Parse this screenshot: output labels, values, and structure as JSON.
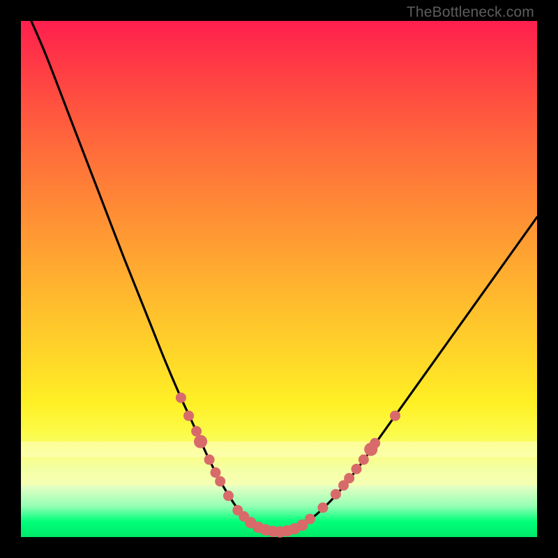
{
  "watermark": "TheBottleneck.com",
  "colors": {
    "frame_bg": "#000000",
    "dot_fill": "#d86a6a",
    "curve_stroke": "#000000"
  },
  "chart_data": {
    "type": "line",
    "title": "",
    "xlabel": "",
    "ylabel": "",
    "xlim": [
      0,
      100
    ],
    "ylim": [
      0,
      100
    ],
    "grid": false,
    "legend": false,
    "series": [
      {
        "name": "bottleneck-curve",
        "x": [
          2,
          5,
          10,
          15,
          20,
          25,
          28,
          31,
          34,
          36,
          38,
          40,
          42,
          44,
          46,
          48,
          50,
          52,
          55,
          60,
          65,
          70,
          75,
          80,
          85,
          90,
          95,
          100
        ],
        "y": [
          100,
          93,
          80,
          67,
          54,
          41.5,
          34,
          27,
          20.5,
          16,
          12,
          8.5,
          5.5,
          3.3,
          2,
          1.2,
          1,
          1.3,
          2.6,
          7,
          13,
          20,
          27,
          34,
          41,
          48,
          55,
          62
        ]
      }
    ],
    "scatter_points": {
      "name": "highlighted-dots",
      "points": [
        {
          "x": 31.0,
          "y": 27.0,
          "r": 1.1
        },
        {
          "x": 32.5,
          "y": 23.5,
          "r": 1.1
        },
        {
          "x": 34.0,
          "y": 20.5,
          "r": 1.1
        },
        {
          "x": 34.8,
          "y": 18.5,
          "r": 1.4
        },
        {
          "x": 36.5,
          "y": 15.0,
          "r": 1.1
        },
        {
          "x": 37.7,
          "y": 12.5,
          "r": 1.1
        },
        {
          "x": 38.6,
          "y": 10.8,
          "r": 1.1
        },
        {
          "x": 40.2,
          "y": 8.0,
          "r": 1.1
        },
        {
          "x": 42.0,
          "y": 5.2,
          "r": 1.1
        },
        {
          "x": 43.2,
          "y": 4.0,
          "r": 1.1
        },
        {
          "x": 44.5,
          "y": 2.8,
          "r": 1.2
        },
        {
          "x": 46.0,
          "y": 1.9,
          "r": 1.2
        },
        {
          "x": 47.4,
          "y": 1.4,
          "r": 1.2
        },
        {
          "x": 48.8,
          "y": 1.1,
          "r": 1.2
        },
        {
          "x": 50.2,
          "y": 1.0,
          "r": 1.2
        },
        {
          "x": 51.6,
          "y": 1.2,
          "r": 1.2
        },
        {
          "x": 53.0,
          "y": 1.6,
          "r": 1.2
        },
        {
          "x": 54.5,
          "y": 2.3,
          "r": 1.2
        },
        {
          "x": 56.0,
          "y": 3.5,
          "r": 1.1
        },
        {
          "x": 58.5,
          "y": 5.7,
          "r": 1.1
        },
        {
          "x": 61.0,
          "y": 8.3,
          "r": 1.1
        },
        {
          "x": 62.5,
          "y": 10.0,
          "r": 1.1
        },
        {
          "x": 63.6,
          "y": 11.4,
          "r": 1.1
        },
        {
          "x": 65.0,
          "y": 13.2,
          "r": 1.1
        },
        {
          "x": 66.4,
          "y": 15.0,
          "r": 1.1
        },
        {
          "x": 67.8,
          "y": 17.0,
          "r": 1.4
        },
        {
          "x": 68.6,
          "y": 18.2,
          "r": 1.1
        },
        {
          "x": 72.5,
          "y": 23.5,
          "r": 1.1
        }
      ]
    },
    "pale_bands": [
      {
        "y_from": 15.5,
        "y_to": 18.5,
        "color": "#ffffc6",
        "opacity": 0.55
      },
      {
        "y_from": 10.0,
        "y_to": 12.5,
        "color": "#fdffa8",
        "opacity": 0.55
      }
    ]
  }
}
